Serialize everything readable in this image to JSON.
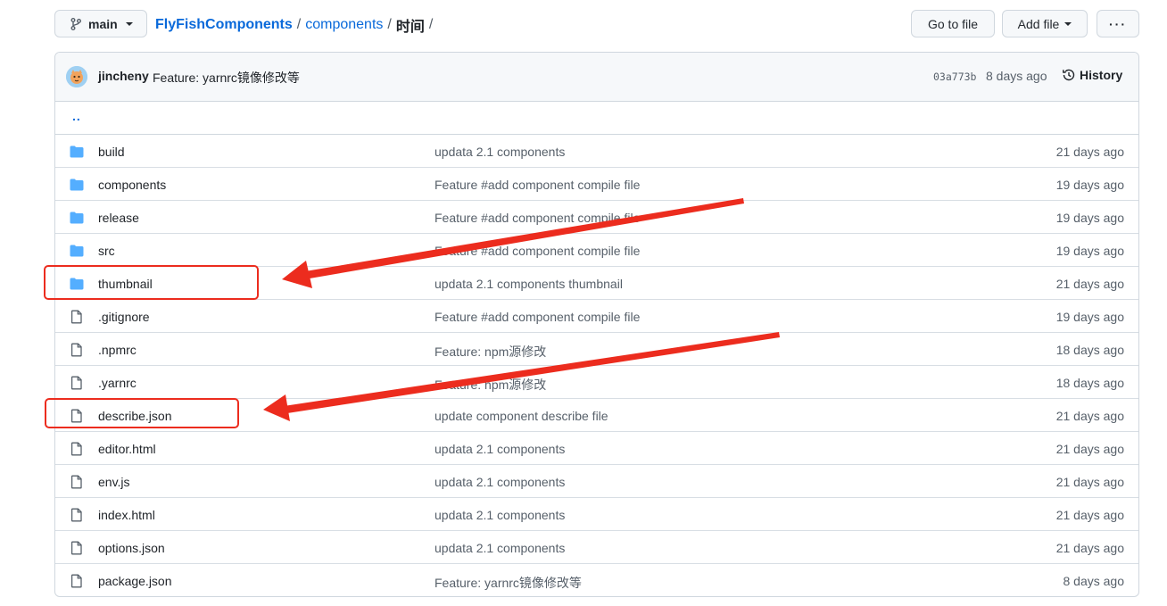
{
  "topbar": {
    "branch": "main",
    "repo": "FlyFishComponents",
    "dir": "components",
    "current": "时间",
    "sep": "/",
    "go_to_file": "Go to file",
    "add_file": "Add file",
    "more": "···"
  },
  "commit": {
    "author": "jincheny",
    "message": "Feature: yarnrc镜像修改等",
    "sha": "03a773b",
    "time": "8 days ago",
    "history": "History"
  },
  "parent_link": "..",
  "files": [
    {
      "type": "dir",
      "name": "build",
      "message": "updata 2.1 components",
      "time": "21 days ago"
    },
    {
      "type": "dir",
      "name": "components",
      "message": "Feature #add component compile file",
      "time": "19 days ago"
    },
    {
      "type": "dir",
      "name": "release",
      "message": "Feature #add component compile file",
      "time": "19 days ago"
    },
    {
      "type": "dir",
      "name": "src",
      "message": "Feature #add component compile file",
      "time": "19 days ago"
    },
    {
      "type": "dir",
      "name": "thumbnail",
      "message": "updata 2.1 components thumbnail",
      "time": "21 days ago"
    },
    {
      "type": "file",
      "name": ".gitignore",
      "message": "Feature #add component compile file",
      "time": "19 days ago"
    },
    {
      "type": "file",
      "name": ".npmrc",
      "message": "Feature: npm源修改",
      "time": "18 days ago"
    },
    {
      "type": "file",
      "name": ".yarnrc",
      "message": "Feature: npm源修改",
      "time": "18 days ago"
    },
    {
      "type": "file",
      "name": "describe.json",
      "message": "update component describe file",
      "time": "21 days ago"
    },
    {
      "type": "file",
      "name": "editor.html",
      "message": "updata 2.1 components",
      "time": "21 days ago"
    },
    {
      "type": "file",
      "name": "env.js",
      "message": "updata 2.1 components",
      "time": "21 days ago"
    },
    {
      "type": "file",
      "name": "index.html",
      "message": "updata 2.1 components",
      "time": "21 days ago"
    },
    {
      "type": "file",
      "name": "options.json",
      "message": "updata 2.1 components",
      "time": "21 days ago"
    },
    {
      "type": "file",
      "name": "package.json",
      "message": "Feature: yarnrc镜像修改等",
      "time": "8 days ago"
    }
  ],
  "colors": {
    "link": "#0969da",
    "folder": "#54aeff",
    "annotation": "#ec2c1e"
  }
}
